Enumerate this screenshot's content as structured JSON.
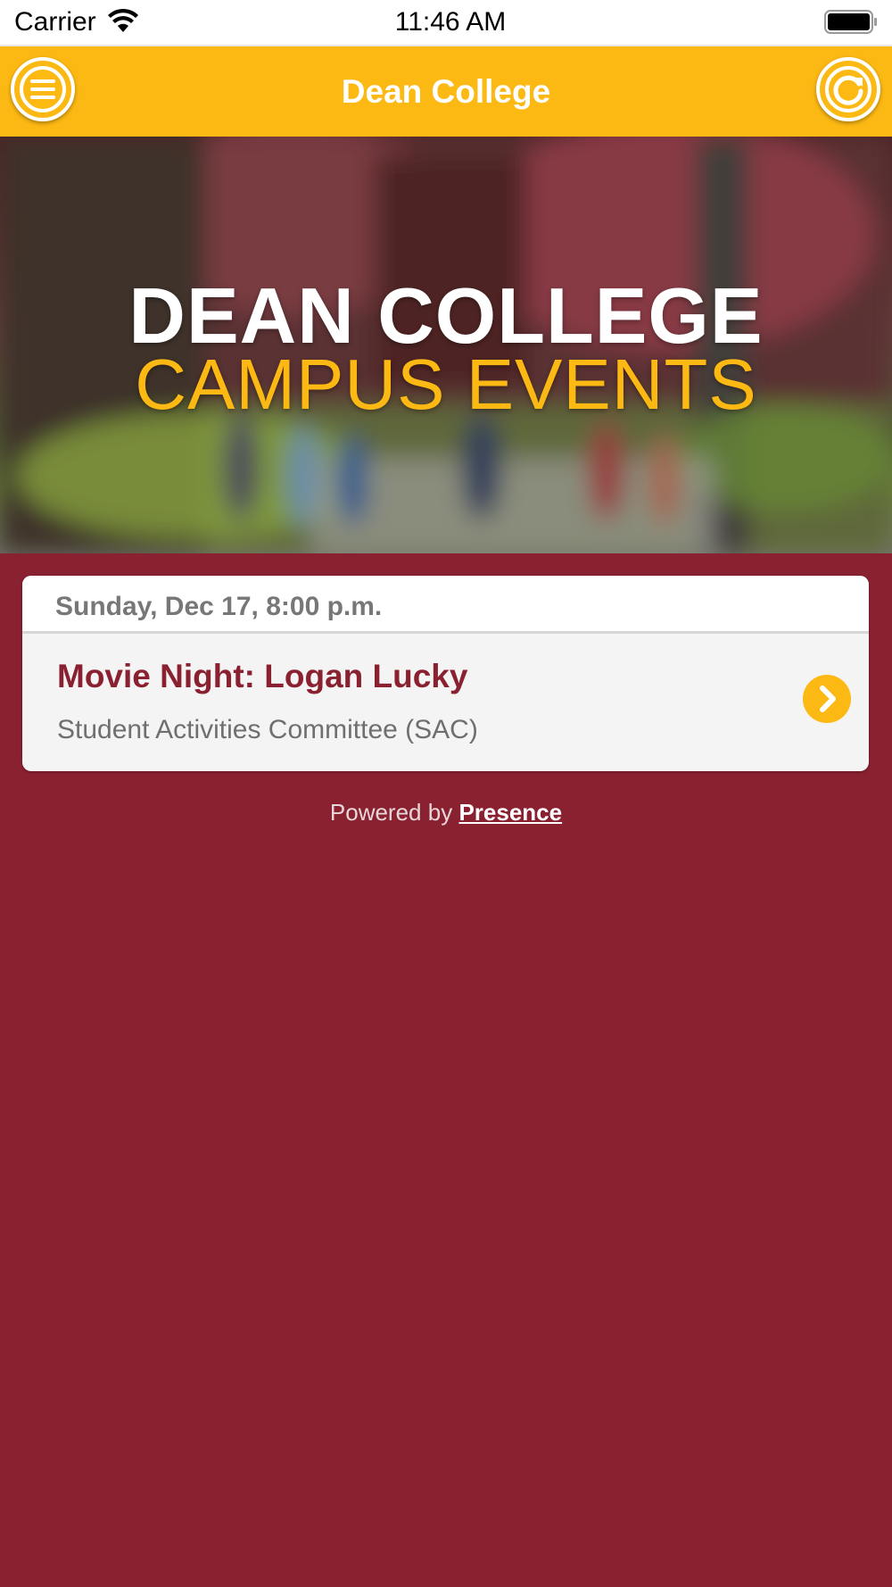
{
  "status_bar": {
    "carrier": "Carrier",
    "time": "11:46 AM",
    "icons": [
      "wifi-icon",
      "battery-icon"
    ]
  },
  "header": {
    "title": "Dean College",
    "left_button_icon": "menu-icon",
    "right_button_icon": "refresh-icon"
  },
  "banner": {
    "line1": "DEAN COLLEGE",
    "line2": "CAMPUS EVENTS"
  },
  "events": [
    {
      "date": "Sunday, Dec 17, 8:00 p.m.",
      "title": "Movie Night: Logan Lucky",
      "organizer": "Student Activities Committee (SAC)",
      "action_icon": "chevron-right-icon"
    }
  ],
  "footer": {
    "powered_prefix": "Powered by",
    "powered_link": "Presence"
  },
  "colors": {
    "brand_gold": "#fdb913",
    "brand_maroon": "#8a2131",
    "card_bg": "#f4f4f4"
  }
}
